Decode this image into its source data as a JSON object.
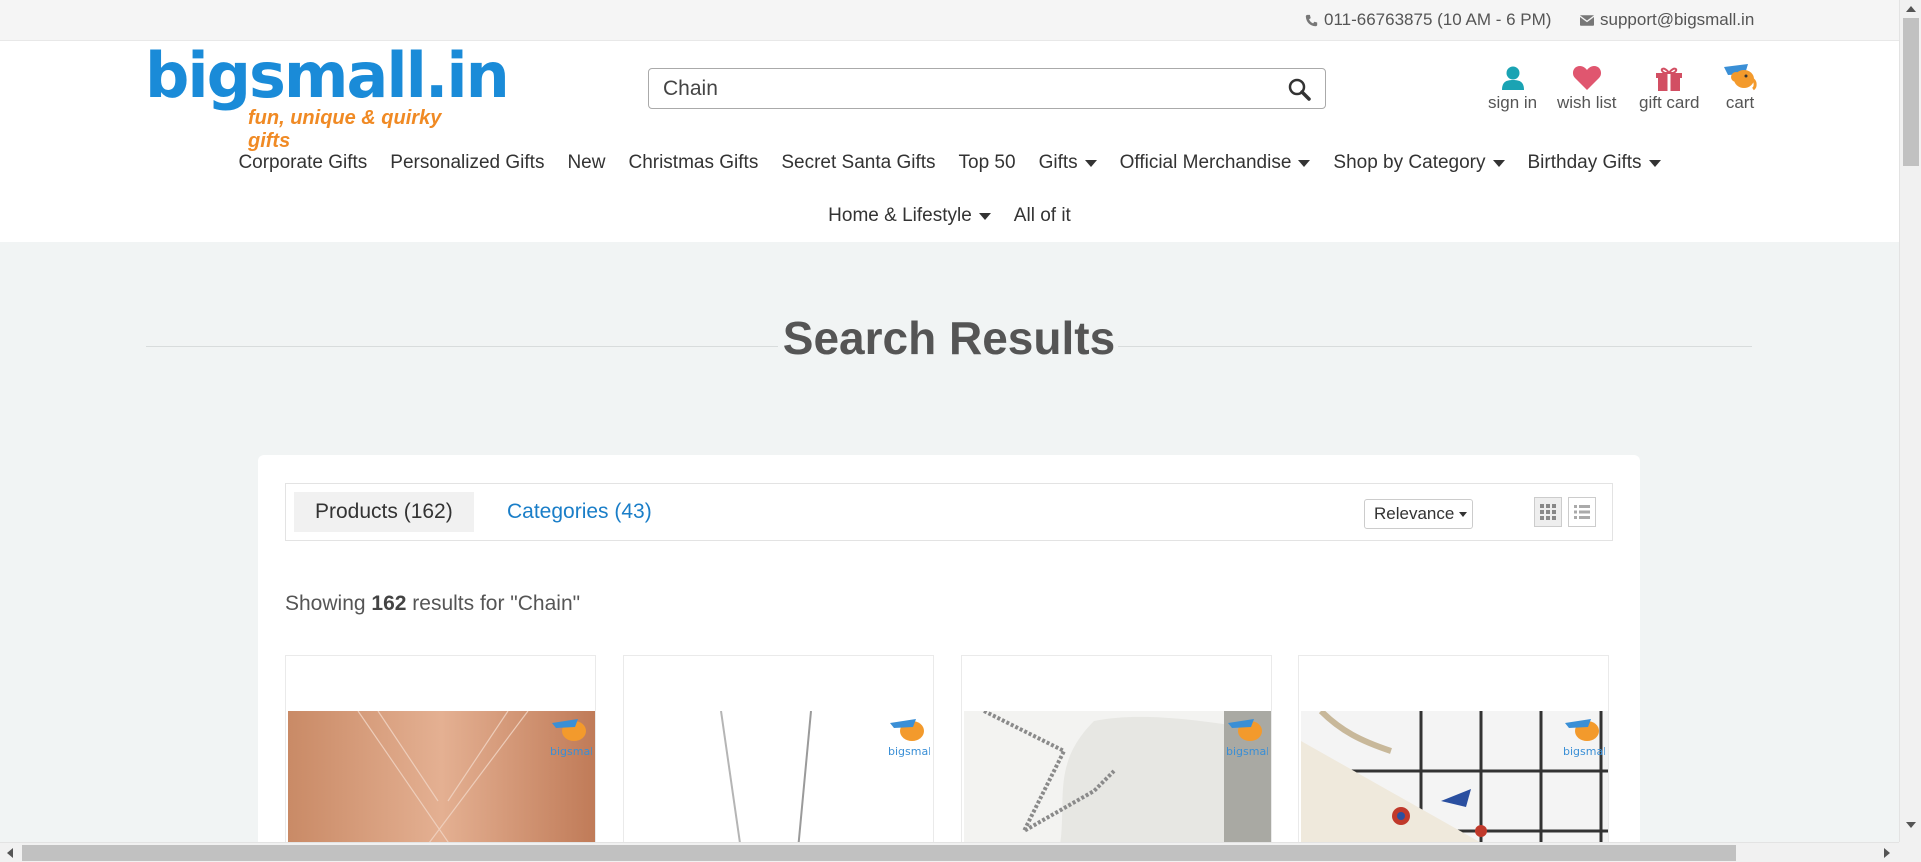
{
  "topbar": {
    "phone": "011-66763875 (10 AM - 6 PM)",
    "email": "support@bigsmall.in"
  },
  "header": {
    "logo_text": "bigsmall.in",
    "logo_tagline": "fun, unique & quirky gifts",
    "search_value": "Chain",
    "utilities": [
      {
        "label": "sign in",
        "icon": "user-icon"
      },
      {
        "label": "wish list",
        "icon": "heart-icon"
      },
      {
        "label": "gift card",
        "icon": "gift-icon"
      },
      {
        "label": "cart",
        "icon": "cart-elephant-icon"
      }
    ]
  },
  "nav": {
    "row1": [
      {
        "label": "Corporate Gifts",
        "dropdown": false
      },
      {
        "label": "Personalized Gifts",
        "dropdown": false
      },
      {
        "label": "New",
        "dropdown": false
      },
      {
        "label": "Christmas Gifts",
        "dropdown": false
      },
      {
        "label": "Secret Santa Gifts",
        "dropdown": false
      },
      {
        "label": "Top 50",
        "dropdown": false
      },
      {
        "label": "Gifts",
        "dropdown": true
      },
      {
        "label": "Official Merchandise",
        "dropdown": true
      },
      {
        "label": "Shop by Category",
        "dropdown": true
      },
      {
        "label": "Birthday Gifts",
        "dropdown": true
      }
    ],
    "row2": [
      {
        "label": "Home & Lifestyle",
        "dropdown": true
      },
      {
        "label": "All of it",
        "dropdown": false
      }
    ]
  },
  "page": {
    "title": "Search Results"
  },
  "results": {
    "tabs": [
      {
        "label": "Products (162)",
        "active": true
      },
      {
        "label": "Categories (43)",
        "active": false
      }
    ],
    "sort_label": "Relevance",
    "showing_prefix": "Showing ",
    "count": "162",
    "showing_suffix": " results for \"Chain\"",
    "products": [
      {
        "image": "rose-gold-cross-chain"
      },
      {
        "image": "silver-long-chain"
      },
      {
        "image": "silver-chain-on-white-cloth"
      },
      {
        "image": "pins-on-canvas-bag"
      }
    ]
  },
  "colors": {
    "brand_blue": "#1a8bd8",
    "brand_orange": "#f08a24",
    "link_blue": "#1a7ec8",
    "page_bg": "#f1f4f4"
  }
}
